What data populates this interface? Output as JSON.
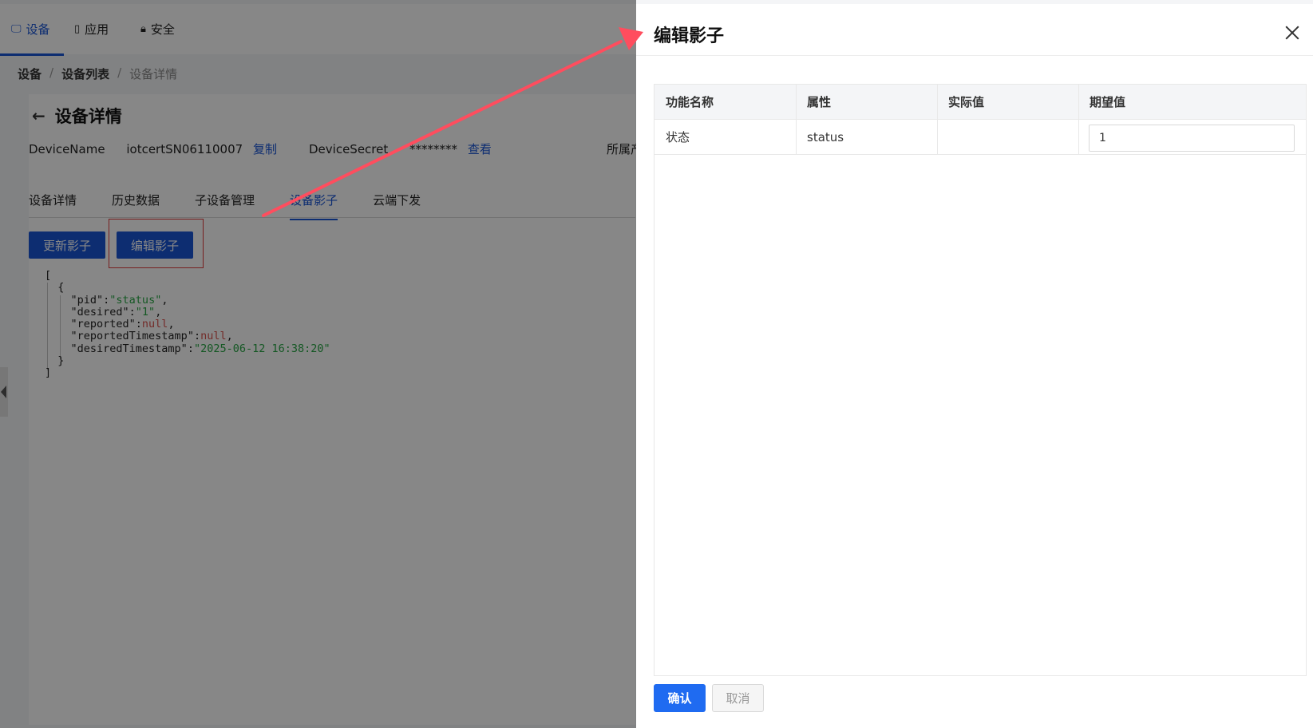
{
  "topnav": {
    "items": [
      {
        "icon": "monitor-icon",
        "label": "设备"
      },
      {
        "icon": "tablet-icon",
        "label": "应用"
      },
      {
        "icon": "lock-icon",
        "label": "安全"
      }
    ]
  },
  "breadcrumb": [
    "设备",
    "/",
    "设备列表",
    "/",
    "设备详情"
  ],
  "page": {
    "title": "设备详情",
    "device_name_label": "DeviceName",
    "device_name_value": "iotcertSN06110007",
    "copy_label": "复制",
    "device_secret_label": "DeviceSecret",
    "device_secret_value": "********",
    "view_label": "查看",
    "product_label": "所属产"
  },
  "tabs": [
    "设备详情",
    "历史数据",
    "子设备管理",
    "设备影子",
    "云端下发"
  ],
  "actions": {
    "update_shadow": "更新影子",
    "edit_shadow": "编辑影子"
  },
  "json": {
    "open_bracket": "[",
    "open_brace": "{",
    "pid_key": "\"pid\":",
    "pid_val": "\"status\"",
    "desired_key": "\"desired\":",
    "desired_val": "\"1\"",
    "reported_key": "\"reported\":",
    "reported_val": "null",
    "reportedTs_key": "\"reportedTimestamp\":",
    "reportedTs_val": "null",
    "desiredTs_key": "\"desiredTimestamp\":",
    "desiredTs_val": "\"2025-06-12 16:38:20\"",
    "close_brace": "}",
    "close_bracket": "]",
    "comma": ","
  },
  "drawer": {
    "title": "编辑影子",
    "columns": [
      "功能名称",
      "属性",
      "实际值",
      "期望值"
    ],
    "rows": [
      {
        "name": "状态",
        "property": "status",
        "actual": "",
        "desired": "1"
      }
    ],
    "confirm_label": "确认",
    "cancel_label": "取消"
  },
  "colors": {
    "primary": "#1f6bf1",
    "highlight": "#e03c3c",
    "annotation_arrow": "#ff4d5e"
  }
}
